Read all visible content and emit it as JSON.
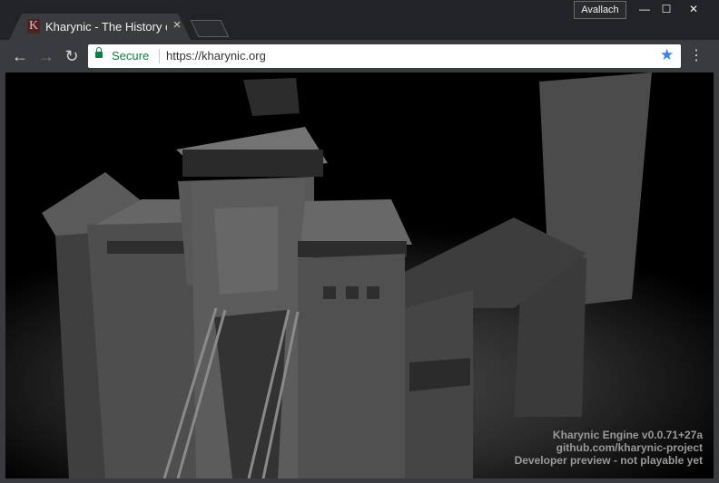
{
  "browser": {
    "tab": {
      "title": "Kharynic - The History of",
      "favicon_letter": "K",
      "close_glyph": "×"
    },
    "profile_label": "Avallach",
    "window_controls": {
      "minimize": "—",
      "maximize": "☐",
      "close": "✕"
    },
    "nav": {
      "back": "←",
      "forward": "→",
      "reload": "↻"
    },
    "omnibox": {
      "security_label": "Secure",
      "url_protocol": "https://",
      "url_host": "kharynic.org",
      "star_color": "#3b82e8",
      "secure_color": "#0b8043"
    },
    "menu_glyph": "⋮"
  },
  "game": {
    "overlay_lines": [
      "Kharynic Engine v0.0.71+27a",
      "github.com/kharynic-project",
      "Developer preview - not playable yet"
    ]
  }
}
